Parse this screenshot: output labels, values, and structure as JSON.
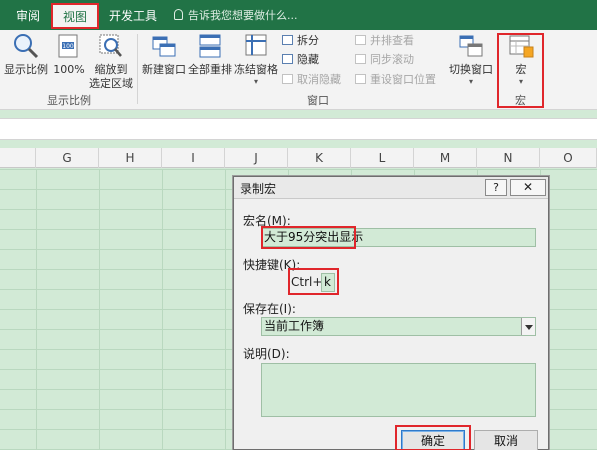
{
  "tabs": [
    {
      "label": "审阅",
      "active": false
    },
    {
      "label": "视图",
      "active": true
    },
    {
      "label": "开发工具",
      "active": false
    }
  ],
  "tell_me": "告诉我您想要做什么...",
  "ribbon": {
    "show_ratio": {
      "label": "显示比例",
      "icon": "magnifier-icon"
    },
    "zoom100": {
      "label": "100%",
      "icon": "zoom-100-icon"
    },
    "zoom_selection": {
      "label_line1": "缩放到",
      "label_line2": "选定区域",
      "icon": "zoom-selection-icon"
    },
    "group_zoom": "显示比例",
    "new_window": {
      "label": "新建窗口",
      "icon": "new-window-icon"
    },
    "arrange_all": {
      "label": "全部重排",
      "icon": "arrange-all-icon"
    },
    "freeze_panes": {
      "label": "冻结窗格",
      "icon": "freeze-panes-icon"
    },
    "split": "拆分",
    "hide": "隐藏",
    "unhide": "取消隐藏",
    "view_side_by_side": "并排查看",
    "sync_scroll": "同步滚动",
    "reset_window_pos": "重设窗口位置",
    "group_window": "窗口",
    "switch_windows": {
      "label": "切换窗口",
      "icon": "switch-windows-icon"
    },
    "macros": {
      "label": "宏",
      "icon": "macros-icon"
    },
    "group_macros": "宏"
  },
  "columns": [
    "G",
    "H",
    "I",
    "J",
    "K",
    "L",
    "M",
    "N",
    "O"
  ],
  "dialog": {
    "title": "录制宏",
    "help": "?",
    "close": "✕",
    "macro_name_label": "宏名(M):",
    "macro_name_value": "大于95分突出显示",
    "shortcut_label": "快捷键(K):",
    "shortcut_prefix": "Ctrl+",
    "shortcut_value": "k",
    "store_in_label": "保存在(I):",
    "store_in_value": "当前工作簿",
    "description_label": "说明(D):",
    "description_value": "",
    "ok": "确定",
    "cancel": "取消"
  },
  "colors": {
    "excel_green": "#217346",
    "highlight_red": "#e0262b",
    "cell_fill": "#d2ead6"
  }
}
